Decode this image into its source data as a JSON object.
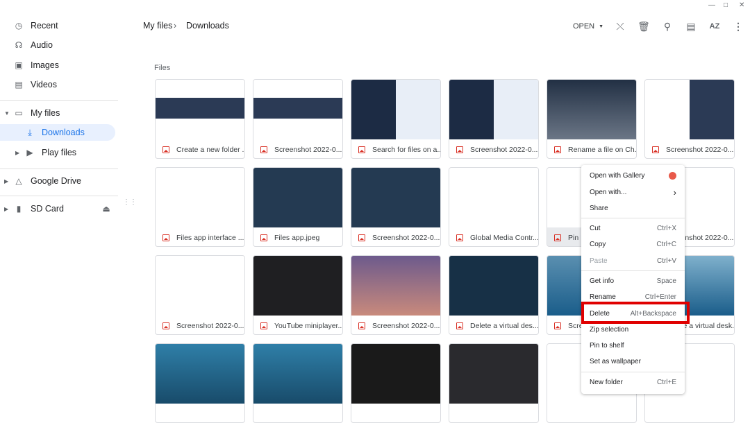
{
  "window_controls": [
    "minimize",
    "maximize",
    "close"
  ],
  "sidebar": {
    "items": [
      {
        "label": "Recent",
        "icon": "clock-icon"
      },
      {
        "label": "Audio",
        "icon": "headphones-icon"
      },
      {
        "label": "Images",
        "icon": "image-icon"
      },
      {
        "label": "Videos",
        "icon": "film-icon"
      },
      {
        "label": "My files",
        "icon": "laptop-icon"
      },
      {
        "label": "Downloads",
        "icon": "download-icon",
        "selected": true
      },
      {
        "label": "Play files",
        "icon": "play-store-icon"
      },
      {
        "label": "Google Drive",
        "icon": "drive-icon"
      },
      {
        "label": "SD Card",
        "icon": "sd-card-icon"
      }
    ]
  },
  "breadcrumb": {
    "root": "My files",
    "current": "Downloads"
  },
  "toolbar": {
    "open_label": "OPEN",
    "icons": [
      "share-icon",
      "delete-icon",
      "search-icon",
      "list-view-icon",
      "sort-icon",
      "more-icon"
    ]
  },
  "section_label": "Files",
  "files": [
    "Create a new folder ...",
    "Screenshot 2022-0...",
    "Search for files on a...",
    "Screenshot 2022-0...",
    "Rename a file on Ch...",
    "Screenshot 2022-0...",
    "Files app interface ...",
    "Files app.jpeg",
    "Screenshot 2022-0...",
    "Global Media Contr...",
    "Pin PiP...",
    "Screenshot 2022-0...",
    "Screenshot 2022-0...",
    "YouTube miniplayer...",
    "Screenshot 2022-0...",
    "Delete a virtual des...",
    "Screenshot...",
    "Delete a virtual desk...",
    "",
    "",
    "",
    "",
    "",
    ""
  ],
  "context_menu": {
    "items": [
      {
        "label": "Open with Gallery",
        "shortcut": ""
      },
      {
        "label": "Open with...",
        "shortcut": ""
      },
      {
        "label": "Share",
        "shortcut": ""
      },
      {
        "label": "Cut",
        "shortcut": "Ctrl+X"
      },
      {
        "label": "Copy",
        "shortcut": "Ctrl+C"
      },
      {
        "label": "Paste",
        "shortcut": "Ctrl+V",
        "disabled": true
      },
      {
        "label": "Get info",
        "shortcut": "Space"
      },
      {
        "label": "Rename",
        "shortcut": "Ctrl+Enter"
      },
      {
        "label": "Delete",
        "shortcut": "Alt+Backspace",
        "highlighted": true
      },
      {
        "label": "Zip selection",
        "shortcut": ""
      },
      {
        "label": "Pin to shelf",
        "shortcut": ""
      },
      {
        "label": "Set as wallpaper",
        "shortcut": ""
      },
      {
        "label": "New folder",
        "shortcut": "Ctrl+E"
      }
    ]
  },
  "colors": {
    "accent": "#1a73e8",
    "selected_bg": "#e8f0fe",
    "highlight_box": "#e00000",
    "file_icon": "#d93025"
  }
}
